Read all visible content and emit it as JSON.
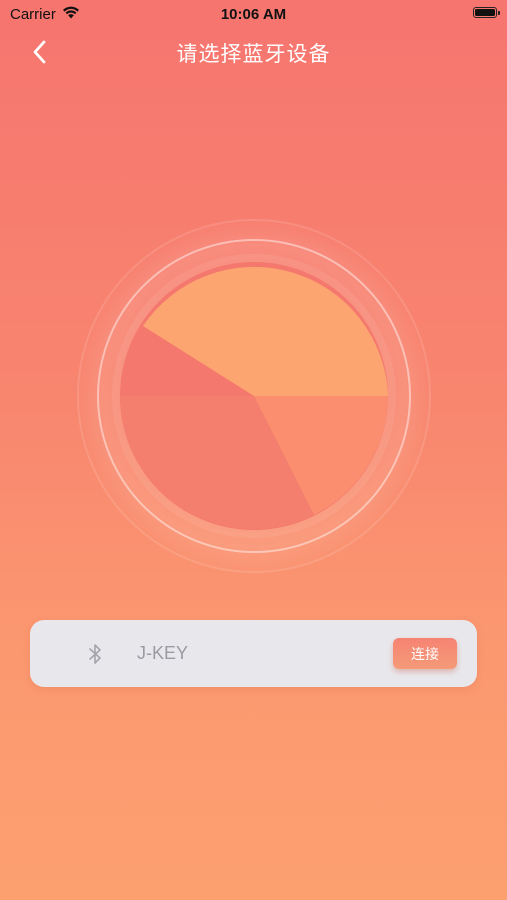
{
  "status_bar": {
    "carrier": "Carrier",
    "time": "10:06 AM",
    "icons": [
      "wifi-icon",
      "battery-icon"
    ]
  },
  "nav": {
    "title": "请选择蓝牙设备",
    "back_icon": "chevron-left-icon"
  },
  "radar": {
    "colors": {
      "ring": "#f7b49a",
      "disc_light": "#fca270",
      "disc_dark": "#f4746c"
    }
  },
  "devices": [
    {
      "icon": "bluetooth-icon",
      "name": "J-KEY",
      "action_label": "连接"
    }
  ],
  "colors": {
    "background_top": "#f6756f",
    "background_bottom": "#fca070",
    "card": "#e8e8ec",
    "device_text": "#9a9aa2"
  }
}
